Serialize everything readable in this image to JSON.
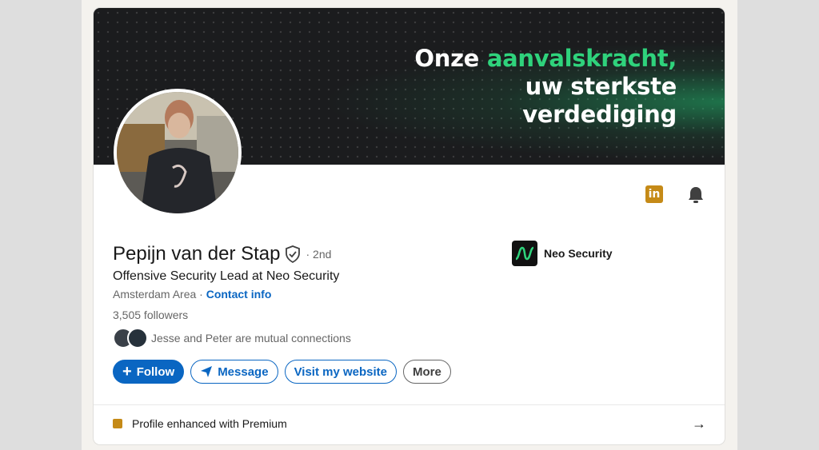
{
  "banner": {
    "line1_plain": "Onze",
    "line1_accent": "aanvalskracht,",
    "line2": "uw sterkste",
    "line3": "verdediging",
    "accent_color": "#2fd37c"
  },
  "profile": {
    "name": "Pepijn van der Stap",
    "degree": "· 2nd",
    "headline": "Offensive Security Lead at Neo Security",
    "location": "Amsterdam Area",
    "location_sep": " · ",
    "contact_label": "Contact info",
    "followers": "3,505 followers",
    "mutual_name1": "Jesse",
    "mutual_and": " and ",
    "mutual_name2": "Peter",
    "mutual_suffix": " are mutual connections"
  },
  "company": {
    "name": "Neo Security"
  },
  "actions": {
    "follow": "Follow",
    "message": "Message",
    "website": "Visit my website",
    "more": "More"
  },
  "premium": {
    "label": "Profile enhanced with Premium"
  },
  "icons": {
    "linkedin_glyph": "in",
    "arrow_glyph": "→",
    "plus_glyph": "+"
  },
  "colors": {
    "primary": "#0a66c2",
    "premium_gold": "#c58a17"
  }
}
